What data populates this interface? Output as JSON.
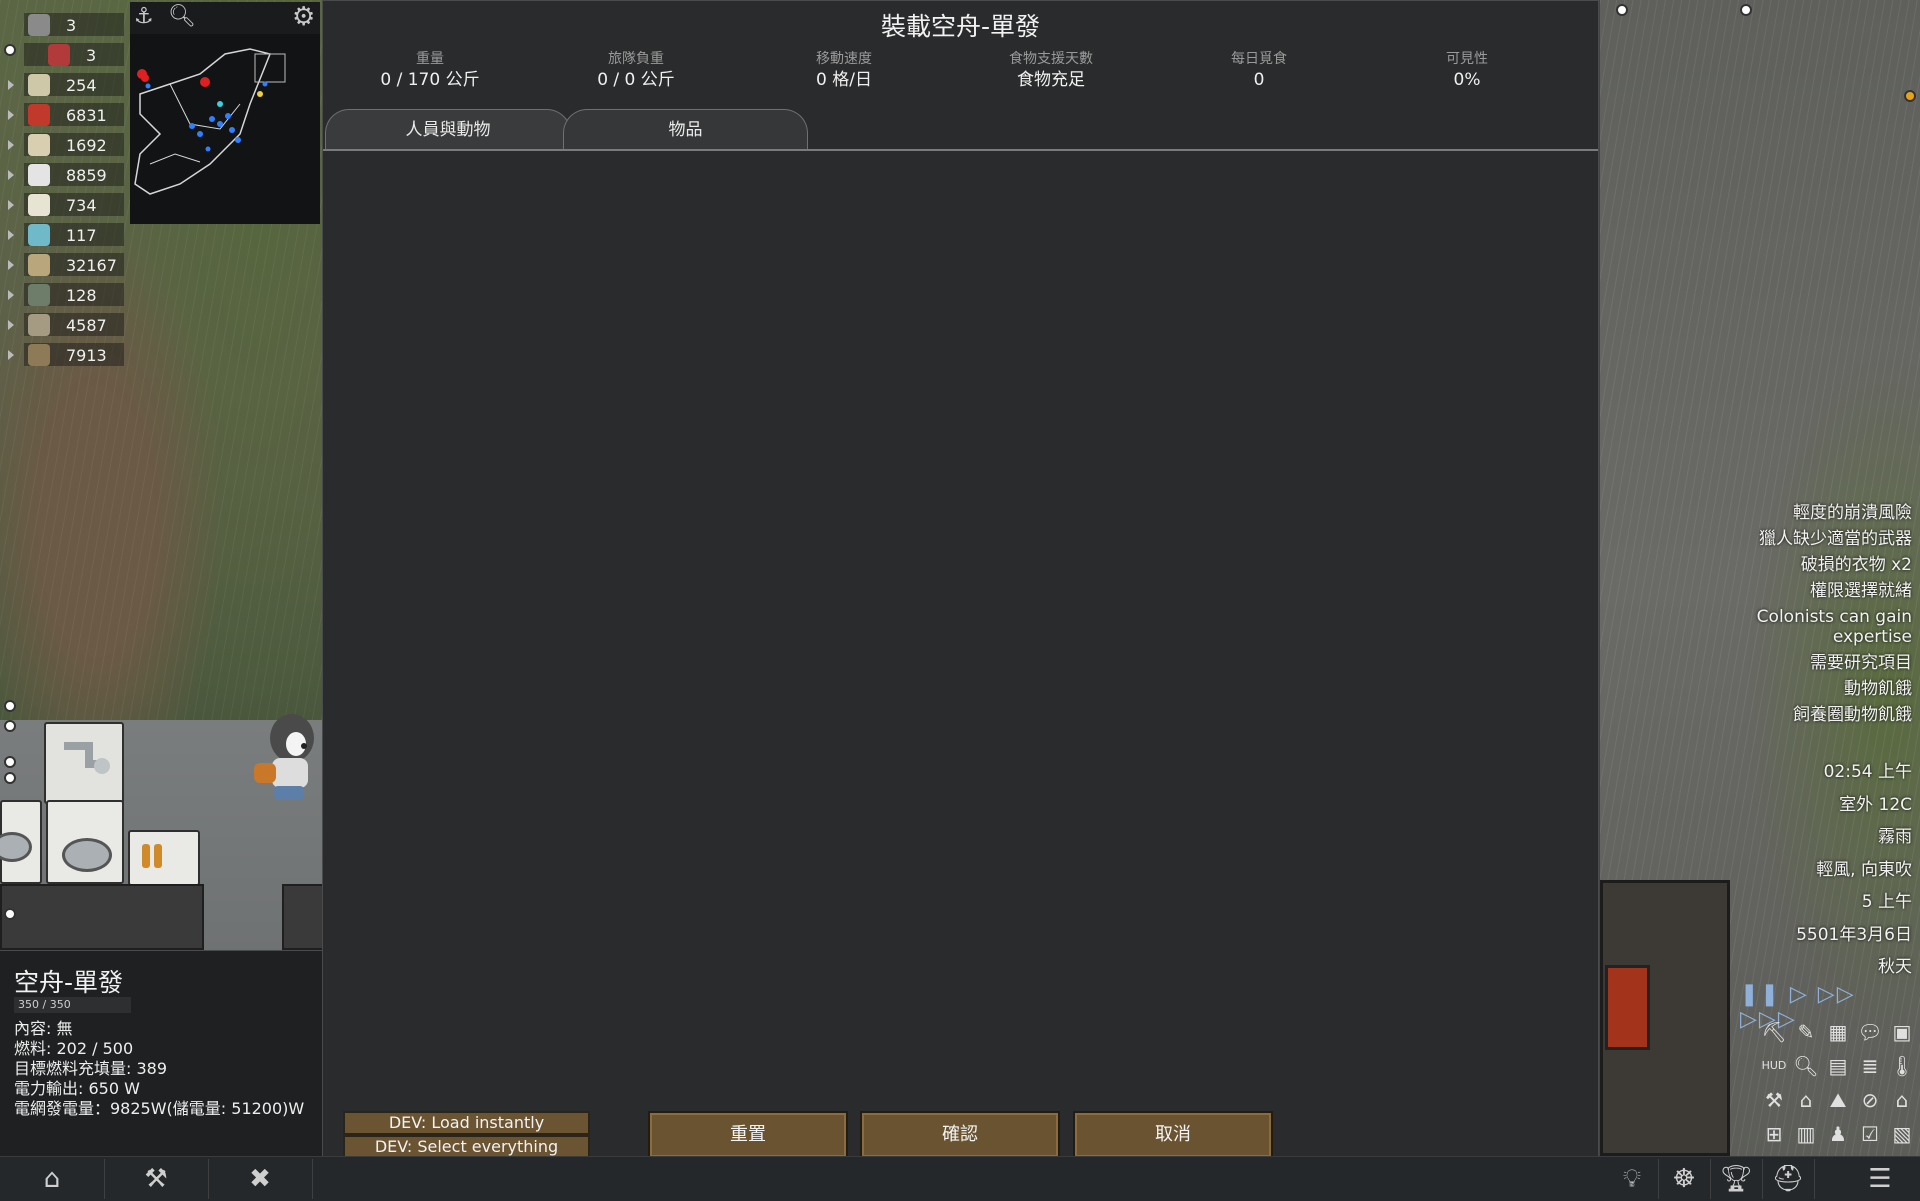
{
  "resources": [
    {
      "icon": "colonist-icon",
      "value": "3",
      "color": "#8a8a8a"
    },
    {
      "icon": "books-icon",
      "value": "3",
      "color": "#b33a3a"
    },
    {
      "icon": "silver-icon",
      "value": "254",
      "color": "#cfc8a8"
    },
    {
      "icon": "strawberry-icon",
      "value": "6831",
      "color": "#c0392b"
    },
    {
      "icon": "wood-plank-icon",
      "value": "1692",
      "color": "#d8cfb0"
    },
    {
      "icon": "cloth-icon",
      "value": "8859",
      "color": "#e4e4e4"
    },
    {
      "icon": "medicine-icon",
      "value": "734",
      "color": "#e8e4d4"
    },
    {
      "icon": "component-icon",
      "value": "117",
      "color": "#6fb9c9"
    },
    {
      "icon": "wood-log-icon",
      "value": "32167",
      "color": "#b9a67d"
    },
    {
      "icon": "plasteel-icon",
      "value": "128",
      "color": "#6e7d6a"
    },
    {
      "icon": "stone-blocks-icon",
      "value": "4587",
      "color": "#a59a82"
    },
    {
      "icon": "crate-icon",
      "value": "7913",
      "color": "#8e7a57"
    }
  ],
  "dialog": {
    "title": "裝載空舟-單發",
    "stats": [
      {
        "label": "重量",
        "value": "0 / 170 公斤"
      },
      {
        "label": "旅隊負重",
        "value": "0 / 0 公斤"
      },
      {
        "label": "移動速度",
        "value": "0 格/日"
      },
      {
        "label": "食物支援天數",
        "value": "食物充足"
      },
      {
        "label": "每日覓食",
        "value": "0"
      },
      {
        "label": "可見性",
        "value": "0%"
      }
    ],
    "tabs": [
      {
        "label": "人員與動物",
        "active": true
      },
      {
        "label": "物品",
        "active": false
      }
    ],
    "dev_load": "DEV: Load instantly",
    "dev_select": "DEV: Select everything",
    "reset": "重置",
    "confirm": "確認",
    "cancel": "取消"
  },
  "inspect": {
    "title": "空舟-單發",
    "hp": "350 / 350",
    "lines": [
      "內容: 無",
      "燃料: 202 / 500",
      "目標燃料充填量: 389",
      "電力輸出: 650 W",
      "電網發電量：9825W(儲電量: 51200)W"
    ]
  },
  "alerts": [
    "輕度的崩潰風險",
    "獵人缺少適當的武器",
    "破損的衣物 x2",
    "權限選擇就緒",
    "Colonists can gain expertise",
    "需要研究項目",
    "動物飢餓",
    "飼養圈動物飢餓"
  ],
  "info": {
    "time": "02:54 上午",
    "temperature": "室外 12C",
    "weather": "霧雨",
    "wind": "輕風, 向東吹",
    "hour": "5 上午",
    "date": "5501年3月6日",
    "season": "秋天"
  },
  "colors": {
    "dialog_bg": "#2a2b2c",
    "button_brown": "#6a5330",
    "panel_dark": "#1e2021"
  }
}
